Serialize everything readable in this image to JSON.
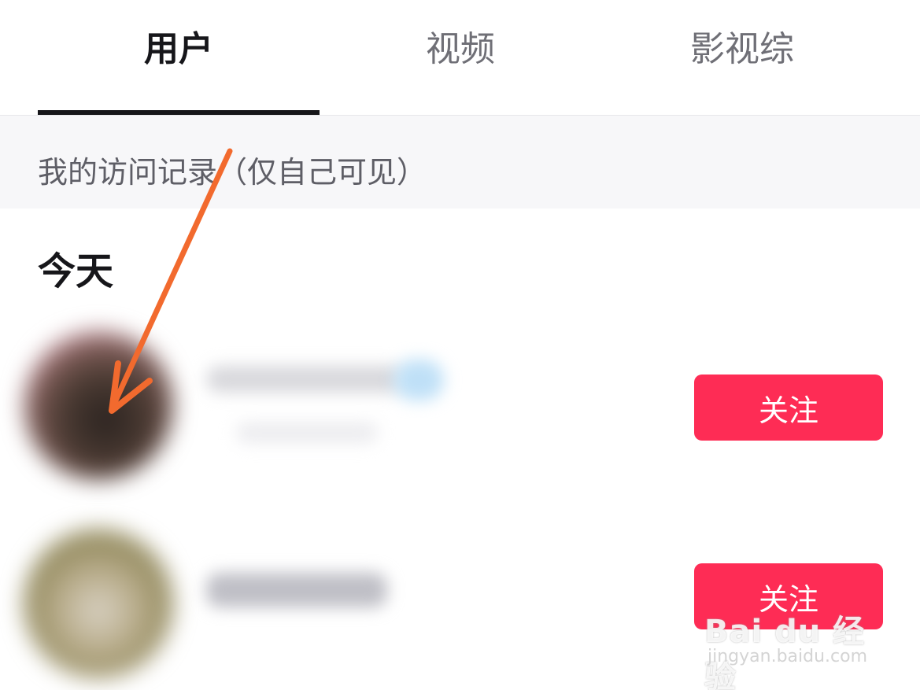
{
  "tabs": [
    {
      "label": "用户",
      "active": true
    },
    {
      "label": "视频",
      "active": false
    },
    {
      "label": "影视综",
      "active": false
    }
  ],
  "notice": {
    "text": "我的访问记录（仅自己可见）"
  },
  "section": {
    "title": "今天"
  },
  "users": [
    {
      "follow_label": "关注"
    },
    {
      "follow_label": "关注"
    }
  ],
  "colors": {
    "accent": "#fe2c55",
    "annotation_arrow": "#f26a2e",
    "text_primary": "#16161a",
    "text_secondary": "#6f6f76"
  },
  "watermark": {
    "main": "Bai du 经验",
    "sub": "jingyan.baidu.com"
  }
}
